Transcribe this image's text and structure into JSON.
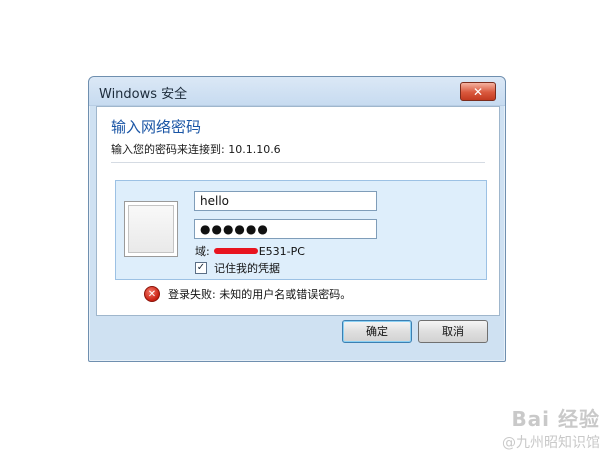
{
  "dialog": {
    "title": "Windows 安全",
    "close_label": "✕",
    "heading": "输入网络密码",
    "subtext": "输入您的密码来连接到: 10.1.10.6",
    "username_value": "hello",
    "password_value": "●●●●●●",
    "domain_label": "域:",
    "domain_suffix": "E531-PC",
    "remember_label": "记住我的凭据",
    "remember_checked": "✓",
    "error_text": "登录失败: 未知的用户名或错误密码。",
    "error_icon_glyph": "✕",
    "ok_label": "确定",
    "cancel_label": "取消"
  },
  "watermark": {
    "main": "Bai 经验",
    "sub": "@九州昭知识馆"
  }
}
